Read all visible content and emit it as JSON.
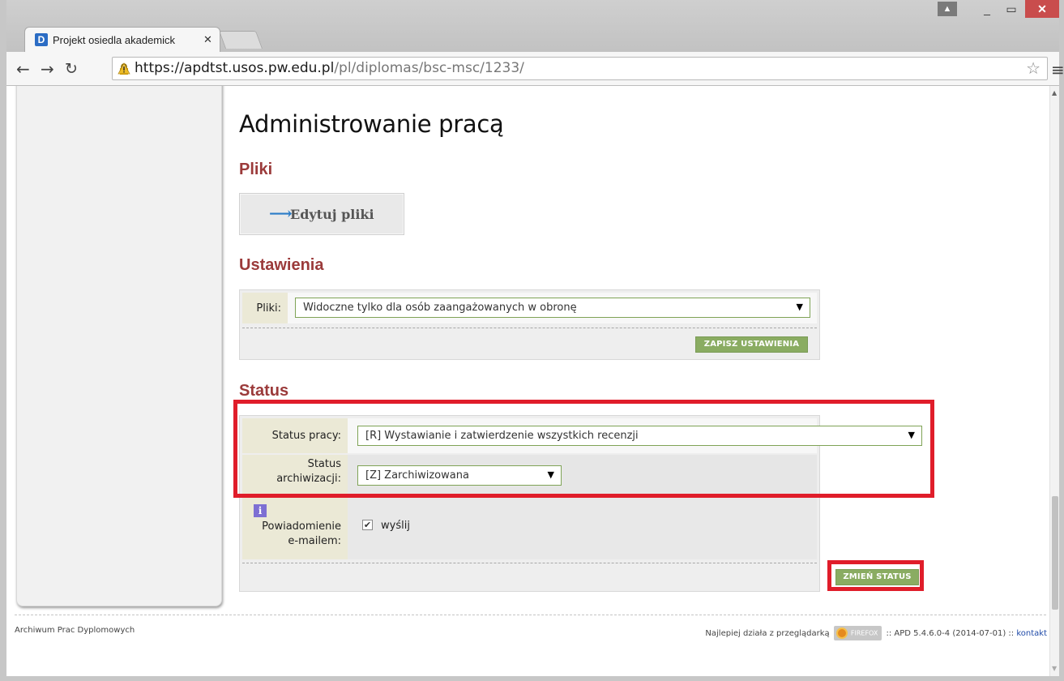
{
  "browser": {
    "tab_title": "Projekt osiedla akademick",
    "tab_favicon": "D",
    "url_scheme": "https://",
    "url_host": "apdtst.usos.pw.edu.pl",
    "url_path": "/pl/diplomas/bsc-msc/1233/",
    "icons": {
      "back": "arrow-left-icon",
      "forward": "arrow-right-icon",
      "reload": "reload-icon",
      "star": "star-icon",
      "menu": "hamburger-menu-icon",
      "user": "user-icon",
      "lock": "warning-lock-icon"
    }
  },
  "page": {
    "title": "Administrowanie pracą",
    "files_section": {
      "heading": "Pliki",
      "edit_button": "Edytuj pliki"
    },
    "settings_section": {
      "heading": "Ustawienia",
      "files_label": "Pliki:",
      "files_value": "Widoczne tylko dla osób zaangażowanych w obronę",
      "save_button": "ZAPISZ USTAWIENIA"
    },
    "status_section": {
      "heading": "Status",
      "work_status_label": "Status pracy:",
      "work_status_value": "[R] Wystawianie i zatwierdzenie wszystkich recenzji",
      "archive_status_label_1": "Status",
      "archive_status_label_2": "archiwizacji:",
      "archive_status_value": "[Z] Zarchiwizowana",
      "notification_label_1": "Powiadomienie",
      "notification_label_2": "e-mailem:",
      "notification_checkbox_label": "wyślij",
      "notification_checked": true,
      "change_button": "ZMIEŃ STATUS"
    }
  },
  "footer": {
    "left": "Archiwum Prac Dyplomowych",
    "best_with": "Najlepiej działa z przeglądarką",
    "browser_badge": "FIREFOX",
    "version": ":: APD 5.4.6.0-4 (2014-07-01) ::",
    "contact": "kontakt"
  },
  "colors": {
    "section_heading": "#9b3a3a",
    "button_green": "#8aac62",
    "highlight_red": "#e01d2a",
    "label_bg": "#ebe9d6"
  }
}
